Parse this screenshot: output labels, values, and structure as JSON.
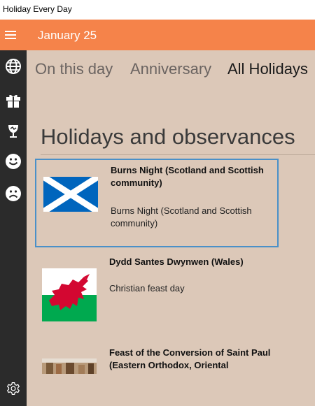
{
  "window": {
    "title": "Holiday Every Day"
  },
  "header": {
    "date": "January 25"
  },
  "sidebar": {
    "icons": [
      "globe-icon",
      "gift-icon",
      "wine-icon",
      "smiley-happy-icon",
      "smiley-sad-icon",
      "settings-icon"
    ]
  },
  "tabs": [
    {
      "label": "On this day",
      "active": false
    },
    {
      "label": "Anniversary",
      "active": false
    },
    {
      "label": "All Holidays",
      "active": true
    }
  ],
  "section": {
    "title": "Holidays and observances"
  },
  "holidays": [
    {
      "name": "Burns Night (Scotland and Scottish community)",
      "description": "Burns Night (Scotland and Scottish community)",
      "flag": "scotland-flag",
      "selected": true
    },
    {
      "name": "Dydd Santes Dwynwen (Wales)",
      "description": "Christian feast day",
      "flag": "wales-flag",
      "selected": false
    },
    {
      "name": "Feast of the Conversion of Saint Paul (Eastern Orthodox, Oriental",
      "description": "",
      "flag": "painting-thumbnail",
      "selected": false
    }
  ],
  "colors": {
    "accent": "#f5834a",
    "sidebar": "#2b2b2b",
    "content_bg": "#dcc8b8",
    "selection_border": "#4a90c8"
  }
}
